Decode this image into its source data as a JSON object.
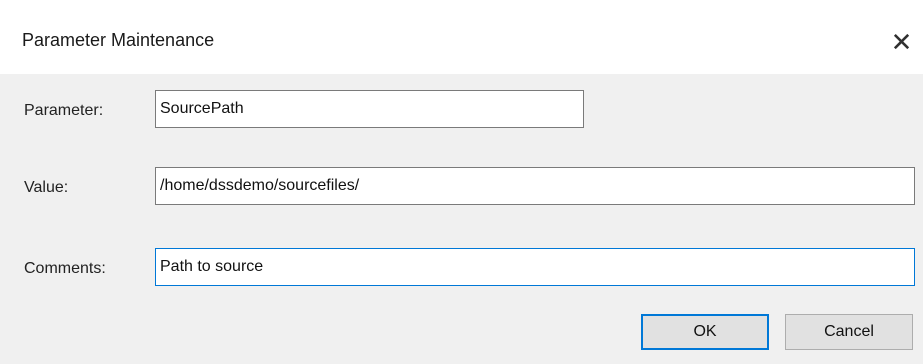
{
  "window": {
    "title": "Parameter Maintenance",
    "close_glyph": "✕"
  },
  "form": {
    "parameter_label": "Parameter:",
    "parameter_value": "SourcePath",
    "value_label": "Value:",
    "value_value": "/home/dssdemo/sourcefiles/",
    "comments_label": "Comments:",
    "comments_value": "Path to source"
  },
  "buttons": {
    "ok_label": "OK",
    "cancel_label": "Cancel"
  },
  "colors": {
    "focus_border": "#0078d7",
    "dialog_bg": "#f0f0f0"
  }
}
